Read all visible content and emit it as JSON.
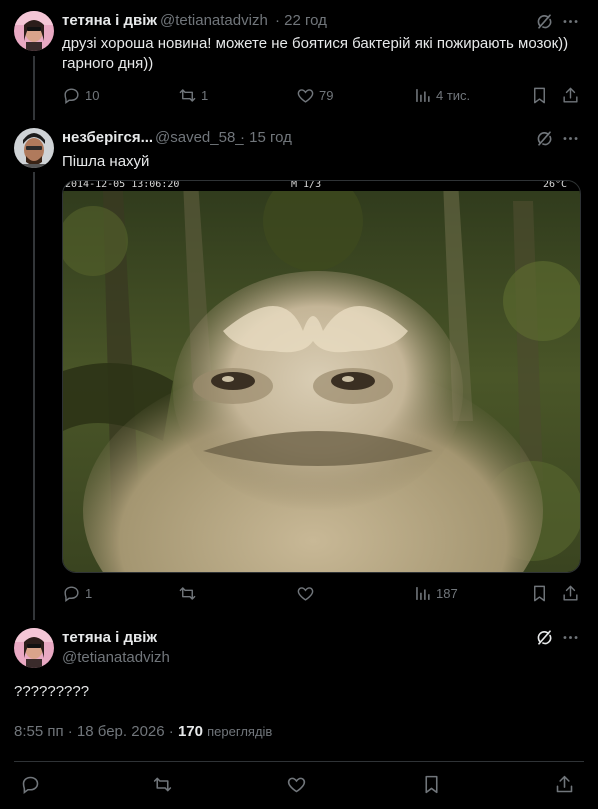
{
  "tweet1": {
    "name": "тетяна і двіж",
    "handle": "@tetianatadvizh",
    "time": "· 22 год",
    "text_line1": "друзі хороша новина! можете не боятися бактерій які пожирають мозок))",
    "text_line2": "гарного дня))",
    "replies": "10",
    "reposts": "1",
    "likes": "79",
    "views": "4 тис."
  },
  "tweet2": {
    "name": "незберігся...",
    "handle": "@saved_58_",
    "time": "· 15 год",
    "text": "Пішла нахуй",
    "image_overlay_left": "2014-12-05 13:06:20",
    "image_overlay_mid": "M 1/3",
    "image_overlay_right": "26°C",
    "replies": "1",
    "reposts": "",
    "likes": "",
    "views": "187"
  },
  "main_tweet": {
    "name": "тетяна і двіж",
    "handle": "@tetianatadvizh",
    "text": "?????????",
    "timestamp": "8:55 пп · 18 бер. 2026 ·",
    "views_count": "170",
    "views_label": "переглядів"
  },
  "icons": {
    "grok": "grok-icon",
    "more": "more-icon",
    "reply": "reply-icon",
    "repost": "repost-icon",
    "like": "like-icon",
    "views": "views-icon",
    "bookmark": "bookmark-icon",
    "share": "share-icon"
  },
  "colors": {
    "background": "#000000",
    "text": "#e7e9ea",
    "muted": "#71767b",
    "divider": "#2f3336"
  }
}
